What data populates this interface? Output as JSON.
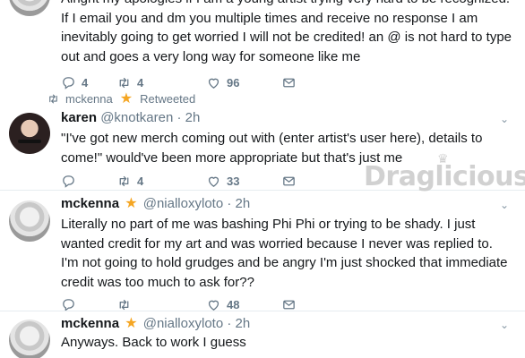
{
  "top_tweet": {
    "text": "Alright my apologies if I am a young artist trying very hard to be recognized. If I email you and dm you multiple times and receive no response I am inevitably going to get worried I will not be credited! an @ is not hard to type out and goes a very long way for someone like me",
    "replies": "4",
    "retweets": "4",
    "likes": "96"
  },
  "retweet_context": {
    "user": "mckenna",
    "label": "Retweeted"
  },
  "tweets": [
    {
      "name": "karen",
      "handle": "@knotkaren",
      "time": "· 2h",
      "text": "\"I've got new merch coming out with (enter artist's user here), details to come!\" would've been more appropriate but that's just me",
      "replies": "",
      "retweets": "4",
      "likes": "33"
    },
    {
      "name": "mckenna",
      "handle": "@nialloxyloto",
      "time": "· 2h",
      "text": "Literally no part of me was bashing Phi Phi or trying to be shady. I just wanted credit for my art and was worried because I never was replied to. I'm not going to hold grudges and be angry I'm just shocked that immediate credit was too much to ask for??",
      "replies": "",
      "retweets": "",
      "likes": "48"
    },
    {
      "name": "mckenna",
      "handle": "@nialloxyloto",
      "time": "· 2h",
      "text": "Anyways. Back to work I guess"
    }
  ],
  "watermark": "Draglicious",
  "icons": {
    "reply": "reply-icon",
    "retweet": "retweet-icon",
    "like": "heart-icon",
    "dm": "envelope-icon",
    "verified_star": "star-icon",
    "more": "chevron-down-icon"
  },
  "colors": {
    "text": "#14171a",
    "secondary": "#657786",
    "star": "#f5a623",
    "divider": "#e6ecf0"
  }
}
